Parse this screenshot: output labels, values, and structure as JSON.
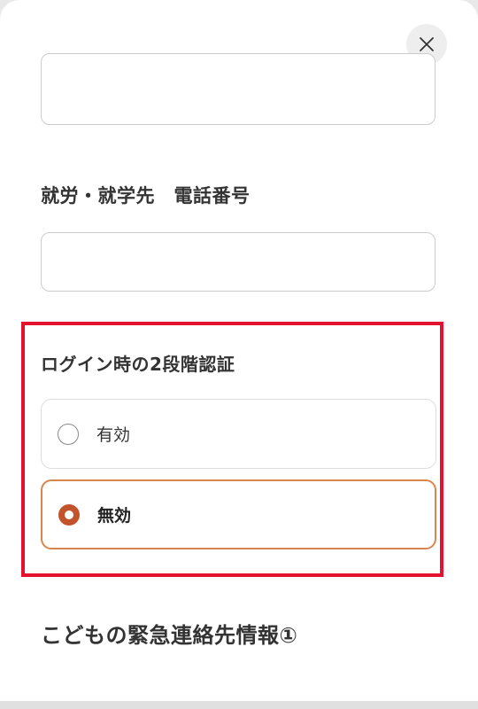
{
  "modal": {
    "close_icon": "close-icon"
  },
  "fields": {
    "work_school_phone": {
      "label": "就労・就学先　電話番号",
      "value": "",
      "placeholder": ""
    }
  },
  "two_factor": {
    "label": "ログイン時の2段階認証",
    "options": [
      {
        "label": "有効",
        "selected": false
      },
      {
        "label": "無効",
        "selected": true
      }
    ]
  },
  "next_section": {
    "title": "こどもの緊急連絡先情報①"
  },
  "colors": {
    "accent": "#c2532a",
    "selected_border": "#d9864e",
    "highlight": "#e4122f"
  }
}
